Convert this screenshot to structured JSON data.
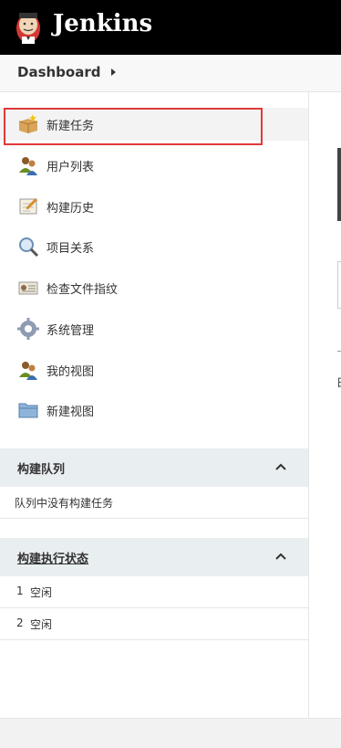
{
  "header": {
    "app_name": "Jenkins",
    "logo_icon": "jenkins-butler-icon"
  },
  "breadcrumb": {
    "item": "Dashboard"
  },
  "sidebar": {
    "tasks": [
      {
        "label": "新建任务",
        "icon": "new-item-icon",
        "highlighted": true
      },
      {
        "label": "用户列表",
        "icon": "users-icon"
      },
      {
        "label": "构建历史",
        "icon": "build-history-icon"
      },
      {
        "label": "项目关系",
        "icon": "magnifier-icon"
      },
      {
        "label": "检查文件指纹",
        "icon": "fingerprint-icon"
      },
      {
        "label": "系统管理",
        "icon": "gear-icon"
      },
      {
        "label": "我的视图",
        "icon": "users-icon"
      },
      {
        "label": "新建视图",
        "icon": "folder-icon"
      }
    ]
  },
  "build_queue": {
    "title": "构建队列",
    "empty_text": "队列中没有构建任务"
  },
  "executors": {
    "title": "构建执行状态",
    "rows": [
      {
        "num": "1",
        "status": "空闲"
      },
      {
        "num": "2",
        "status": "空闲"
      }
    ]
  },
  "main": {
    "fragment_text": "日"
  },
  "colors": {
    "header_bg": "#000000",
    "highlight_border": "#e2393a",
    "pane_header_bg": "#e9eef0"
  }
}
